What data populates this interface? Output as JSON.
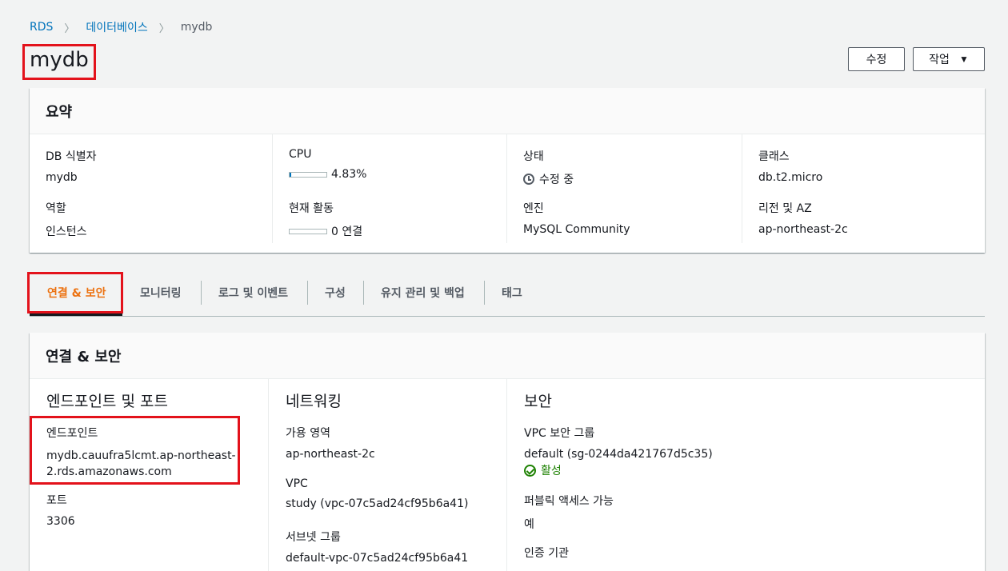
{
  "breadcrumb": {
    "items": [
      "RDS",
      "데이터베이스"
    ],
    "current": "mydb"
  },
  "page_title": "mydb",
  "buttons": {
    "edit": "수정",
    "actions": "작업"
  },
  "summary": {
    "title": "요약",
    "db_id_label": "DB 식별자",
    "db_id_value": "mydb",
    "role_label": "역할",
    "role_value": "인스턴스",
    "cpu_label": "CPU",
    "cpu_value": "4.83%",
    "cpu_fraction": 0.0483,
    "activity_label": "현재 활동",
    "activity_value": "0 연결",
    "status_label": "상태",
    "status_value": "수정 중",
    "engine_label": "엔진",
    "engine_value": "MySQL Community",
    "class_label": "클래스",
    "class_value": "db.t2.micro",
    "region_label": "리전 및 AZ",
    "region_value": "ap-northeast-2c"
  },
  "tabs": [
    "연결 & 보안",
    "모니터링",
    "로그 및 이벤트",
    "구성",
    "유지 관리 및 백업",
    "태그"
  ],
  "connectivity": {
    "title": "연결 & 보안",
    "endpoint_col": {
      "title": "엔드포인트 및 포트",
      "endpoint_label": "엔드포인트",
      "endpoint_line1": "mydb.cauufra5lcmt.ap-northeast-",
      "endpoint_line2": "2.rds.amazonaws.com",
      "port_label": "포트",
      "port_value": "3306"
    },
    "network_col": {
      "title": "네트워킹",
      "az_label": "가용 영역",
      "az_value": "ap-northeast-2c",
      "vpc_label": "VPC",
      "vpc_value": "study (vpc-07c5ad24cf95b6a41)",
      "subnet_label": "서브넷 그룹",
      "subnet_value": "default-vpc-07c5ad24cf95b6a41"
    },
    "security_col": {
      "title": "보안",
      "sg_label": "VPC 보안 그룹",
      "sg_value": "default (sg-0244da421767d5c35)",
      "sg_status": "활성",
      "public_label": "퍼블릭 액세스 가능",
      "public_value": "예",
      "ca_label": "인증 기관"
    }
  },
  "colors": {
    "link": "#0073bb",
    "active_tab": "#ec7211",
    "highlight": "#e3121b",
    "success": "#1d8102"
  }
}
